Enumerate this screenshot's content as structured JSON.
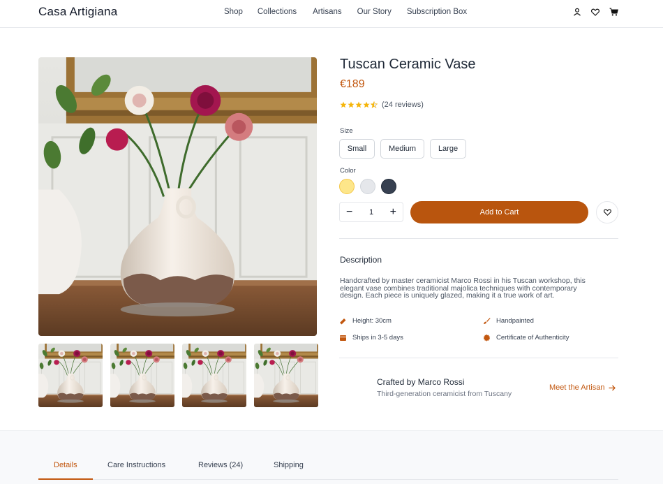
{
  "brand": "Casa Artigiana",
  "nav": [
    "Shop",
    "Collections",
    "Artisans",
    "Our Story",
    "Subscription Box"
  ],
  "header_icons": [
    "user-icon",
    "heart-icon",
    "cart-icon"
  ],
  "product": {
    "title": "Tuscan Ceramic Vase",
    "price": "€189",
    "rating": 4.5,
    "reviews": "(24 reviews)",
    "size_label": "Size",
    "sizes": [
      "Small",
      "Medium",
      "Large"
    ],
    "color_label": "Color",
    "colors": [
      "#fde68a",
      "#e5e7eb",
      "#374151"
    ],
    "quantity": "1",
    "minus": "−",
    "plus": "+",
    "add_to_cart": "Add to Cart"
  },
  "description": {
    "title": "Description",
    "lines": [
      "Handcrafted by master ceramicist Marco Rossi in his Tuscan workshop, this",
      "elegant vase combines traditional majolica techniques with contemporary",
      "design. Each piece is uniquely glazed, making it a true work of art."
    ]
  },
  "features": [
    {
      "icon": "ruler-icon",
      "label": "Height: 30cm"
    },
    {
      "icon": "paintbrush-icon",
      "label": "Handpainted"
    },
    {
      "icon": "box-icon",
      "label": "Ships in 3-5 days"
    },
    {
      "icon": "certificate-icon",
      "label": "Certificate of Authenticity"
    }
  ],
  "artisan": {
    "name": "Crafted by Marco Rossi",
    "subtitle": "Third-generation ceramicist from Tuscany",
    "link": "Meet the Artisan"
  },
  "tabs": [
    "Details",
    "Care Instructions",
    "Reviews (24)",
    "Shipping"
  ],
  "active_tab": "Details",
  "colors": {
    "accent": "#b9550e",
    "accent_text": "#c2570f",
    "star": "#f5b50a"
  }
}
